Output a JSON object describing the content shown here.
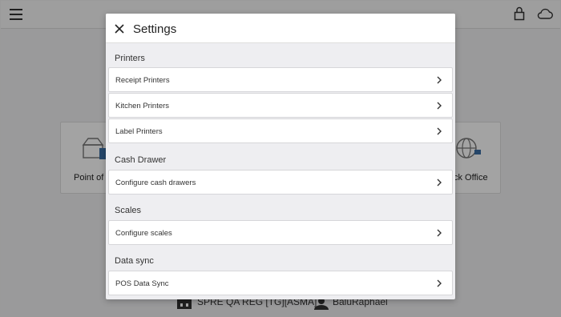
{
  "background": {
    "tiles": [
      {
        "label": "Point of S"
      },
      {
        "label": "ck Office"
      }
    ],
    "footer": {
      "store_name": "SPRE QA REG [TG][ASMA]",
      "user_name": "BaluRaphael"
    }
  },
  "dialog": {
    "title": "Settings",
    "sections": {
      "printers": {
        "title": "Printers",
        "rows": [
          "Receipt Printers",
          "Kitchen Printers",
          "Label Printers"
        ]
      },
      "cash_drawer": {
        "title": "Cash Drawer",
        "rows": [
          "Configure cash drawers"
        ]
      },
      "scales": {
        "title": "Scales",
        "rows": [
          "Configure scales"
        ]
      },
      "data_sync": {
        "title": "Data sync",
        "rows": [
          "POS Data Sync"
        ]
      }
    }
  },
  "icons": {
    "menu": "hamburger-menu-icon",
    "lock": "lock-icon",
    "cloud": "cloud-icon",
    "close": "close-icon",
    "chevron": "chevron-right-icon"
  },
  "colors": {
    "overlay": "#5e5e5e",
    "dialog_background": "#eeeef1",
    "row_background": "#ffffff"
  }
}
